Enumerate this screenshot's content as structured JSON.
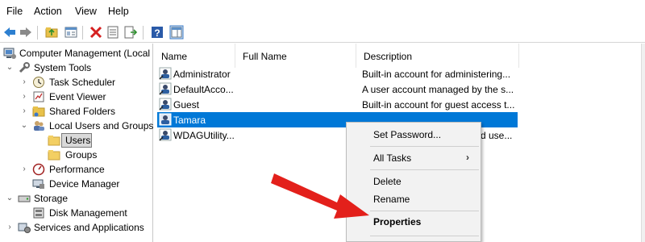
{
  "menubar": {
    "file": "File",
    "action": "Action",
    "view": "View",
    "help": "Help"
  },
  "toolbar": {
    "icons": [
      "back-arrow-icon",
      "forward-arrow-icon",
      "up-folder-icon",
      "show-hide-tree-icon",
      "delete-icon",
      "properties-icon",
      "export-list-icon",
      "help-icon",
      "show-hide-action-pane-icon"
    ]
  },
  "tree": {
    "root": "Computer Management (Local",
    "system_tools": "System Tools",
    "task_scheduler": "Task Scheduler",
    "event_viewer": "Event Viewer",
    "shared_folders": "Shared Folders",
    "local_users_groups": "Local Users and Groups",
    "users": "Users",
    "groups": "Groups",
    "performance": "Performance",
    "device_manager": "Device Manager",
    "storage": "Storage",
    "disk_management": "Disk Management",
    "services_apps": "Services and Applications"
  },
  "list": {
    "columns": {
      "name": "Name",
      "full_name": "Full Name",
      "description": "Description"
    },
    "rows": [
      {
        "name": "Administrator",
        "full_name": "",
        "description": "Built-in account for administering..."
      },
      {
        "name": "DefaultAcco...",
        "full_name": "",
        "description": "A user account managed by the s..."
      },
      {
        "name": "Guest",
        "full_name": "",
        "description": "Built-in account for guest access t..."
      },
      {
        "name": "Tamara",
        "full_name": "",
        "description": ""
      },
      {
        "name": "WDAGUtility...",
        "full_name": "",
        "description": "d use..."
      }
    ],
    "selected_row": "Tamara"
  },
  "context_menu": {
    "set_password": "Set Password...",
    "all_tasks": "All Tasks",
    "delete": "Delete",
    "rename": "Rename",
    "properties": "Properties"
  },
  "colors": {
    "selection": "#0078d7",
    "annotation_arrow": "#e3201b"
  }
}
